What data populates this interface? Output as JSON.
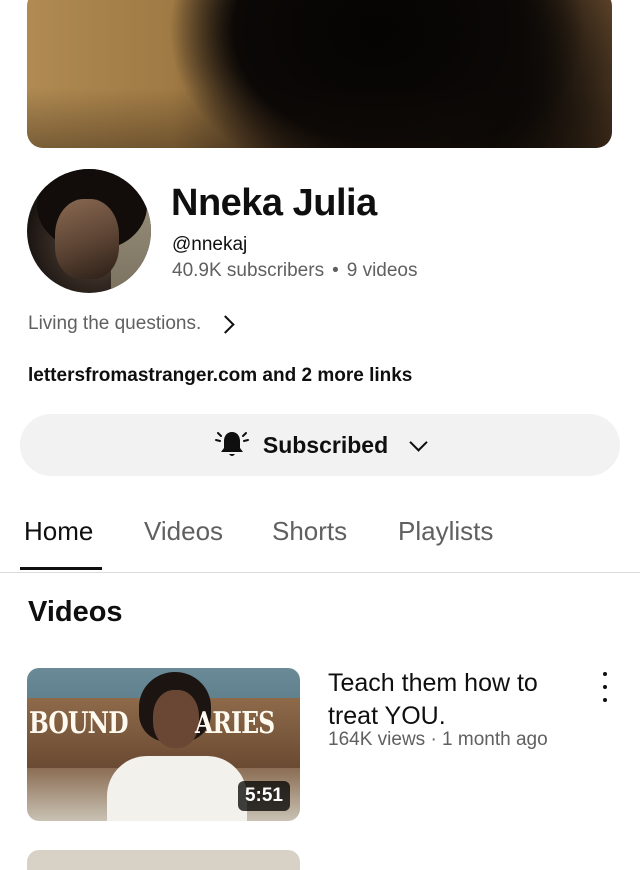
{
  "channel": {
    "name": "Nneka Julia",
    "handle": "@nnekaj",
    "subscribers": "40.9K subscribers",
    "separator": "•",
    "video_count": "9 videos",
    "description": "Living the questions.",
    "links": "lettersfromastranger.com and 2 more links"
  },
  "subscribe_button": {
    "label": "Subscribed",
    "icon": "bell-icon"
  },
  "tabs": [
    {
      "label": "Home",
      "active": true
    },
    {
      "label": "Videos",
      "active": false
    },
    {
      "label": "Shorts",
      "active": false
    },
    {
      "label": "Playlists",
      "active": false
    }
  ],
  "section": {
    "title": "Videos"
  },
  "videos": [
    {
      "title": "Teach them how to treat YOU.",
      "meta": "164K views · 1 month ago",
      "duration": "5:51",
      "thumbnail_text_left": "BOUND",
      "thumbnail_text_right": "ARIES"
    }
  ],
  "colors": {
    "primary_text": "#0f0f0f",
    "secondary_text": "#606060",
    "button_bg": "#f2f2f2"
  }
}
